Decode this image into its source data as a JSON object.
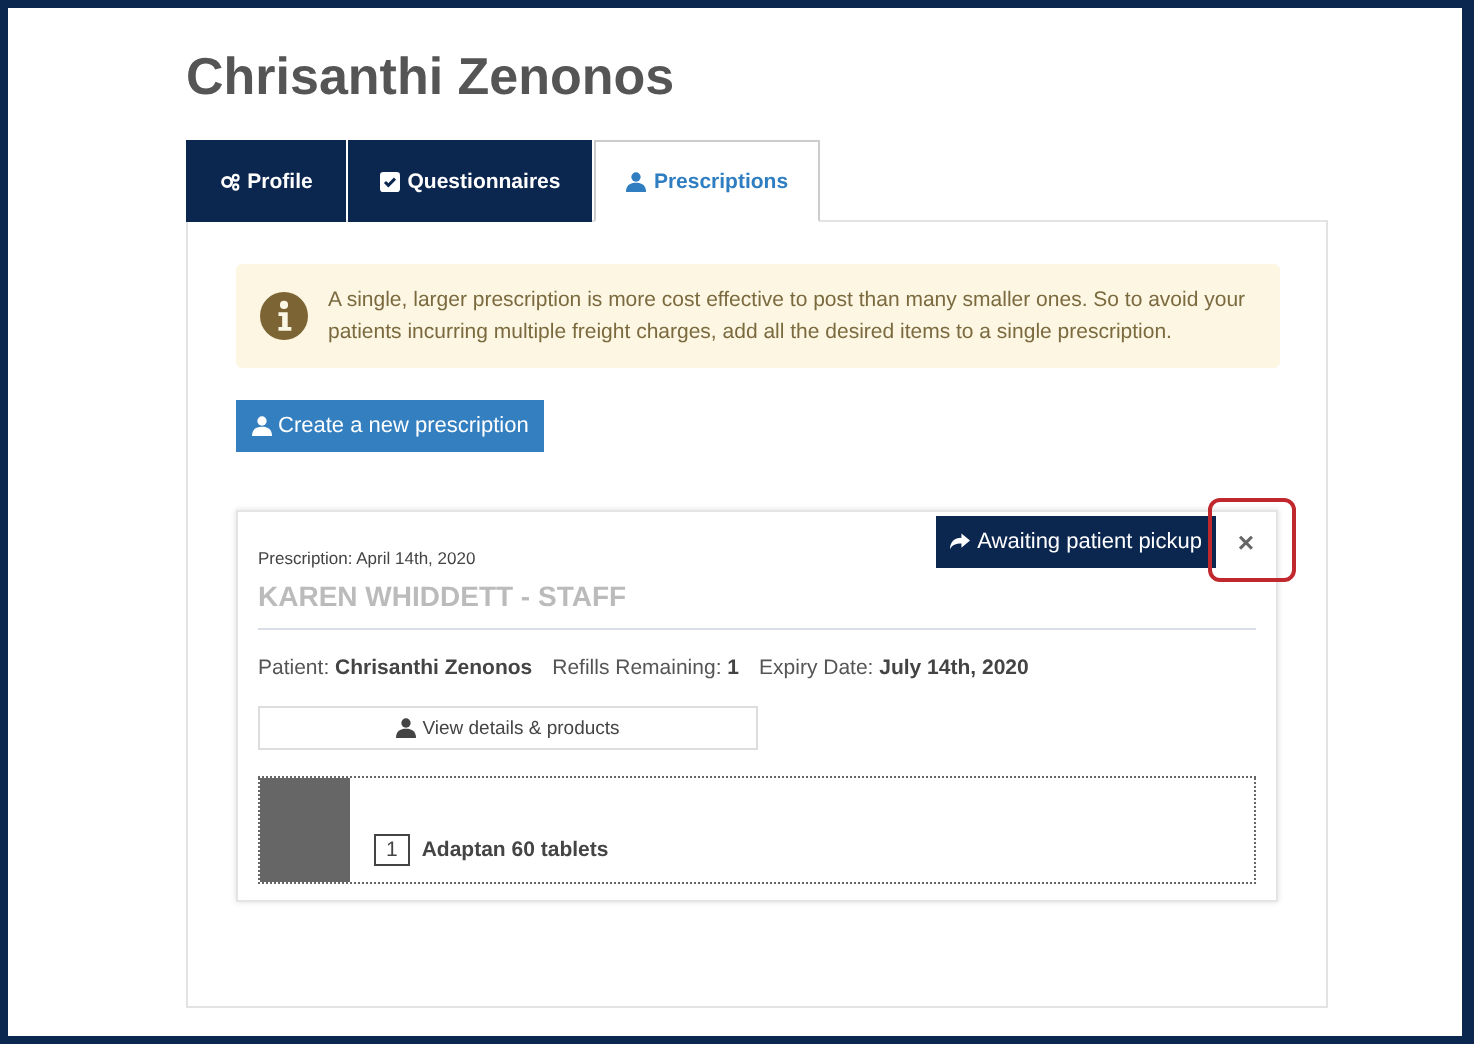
{
  "page_title": "Chrisanthi Zenonos",
  "tabs": [
    {
      "label": "Profile",
      "kind": "gears",
      "selected": false
    },
    {
      "label": "Questionnaires",
      "kind": "check",
      "selected": false
    },
    {
      "label": "Prescriptions",
      "kind": "user",
      "selected": true
    }
  ],
  "alert": {
    "text": "A single, larger prescription is more cost effective to post than many smaller ones. So to avoid your patients incurring multiple freight charges, add all the desired items to a single prescription."
  },
  "create_button": "Create a new prescription",
  "prescription": {
    "date": "Prescription: April 14th, 2020",
    "prescriber": "KAREN WHIDDETT - STAFF",
    "status": "Awaiting patient pickup",
    "close": "×",
    "close_highlighted": true,
    "details": [
      {
        "label": "Patient:",
        "value": "Chrisanthi Zenonos"
      },
      {
        "label": "Refills Remaining:",
        "value": "1"
      },
      {
        "label": "Expiry Date:",
        "value": "July 14th, 2020"
      }
    ],
    "view_button": "View details & products",
    "items": [
      {
        "qty": "1",
        "name": "Adaptan 60 tablets"
      }
    ]
  }
}
